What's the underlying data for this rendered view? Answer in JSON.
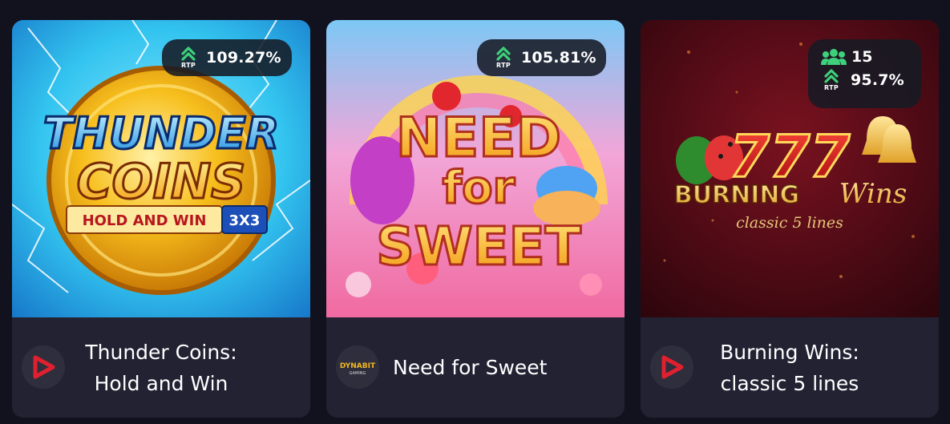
{
  "games": [
    {
      "title_line1": "Thunder Coins:",
      "title_line2": "Hold and Win",
      "rtp_caption": "RTP",
      "rtp": "109.27%",
      "provider_logo": "red-play-triangle-logo",
      "art": {
        "line1": "THUNDER",
        "line2": "COINS",
        "line3": "HOLD AND WIN",
        "line4": "3X3"
      }
    },
    {
      "title": "Need for Sweet",
      "rtp_caption": "RTP",
      "rtp": "105.81%",
      "provider_logo": {
        "line1": "DYNABIT",
        "line2": "GAMING"
      },
      "art": {
        "line1": "NEED",
        "line2": "for",
        "line3": "SWEET"
      }
    },
    {
      "title_line1": "Burning Wins:",
      "title_line2": "classic 5 lines",
      "players": "15",
      "rtp_caption": "RTP",
      "rtp": "95.7%",
      "provider_logo": "red-play-triangle-logo",
      "art": {
        "line1": "777",
        "line2": "BURNING",
        "line3": "Wins",
        "line4": "classic 5 lines"
      }
    }
  ],
  "colors": {
    "page_background": "#12121f",
    "card_footer": "#222233",
    "badge_background": "#161a24",
    "rtp_arrow": "#3ed07a",
    "players_icon": "#3ed07a",
    "provider_red": "#e0202e"
  }
}
